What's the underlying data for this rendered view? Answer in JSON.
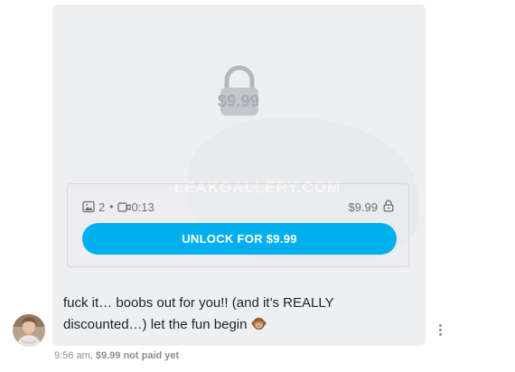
{
  "media": {
    "lock_price": "$9.99",
    "watermark": "LEAKGALLERY.COM",
    "photo_count": "2",
    "separator": "•",
    "video_duration": "0:13",
    "price": "$9.99",
    "unlock_label": "UNLOCK FOR $9.99",
    "icons": [
      "image-icon",
      "video-icon",
      "lock-icon",
      "padlock-icon"
    ]
  },
  "message": {
    "line1": "fuck it… boobs out for you!! (and it’s REALLY",
    "line2": "discounted…) let the fun begin",
    "emoji": "monkey-emoji"
  },
  "meta": {
    "time": "9:56 am,",
    "paid_status": "$9.99 not paid yet"
  },
  "colors": {
    "accent": "#00aff0",
    "bubble": "#eeeff1",
    "muted": "#8a8d92"
  }
}
